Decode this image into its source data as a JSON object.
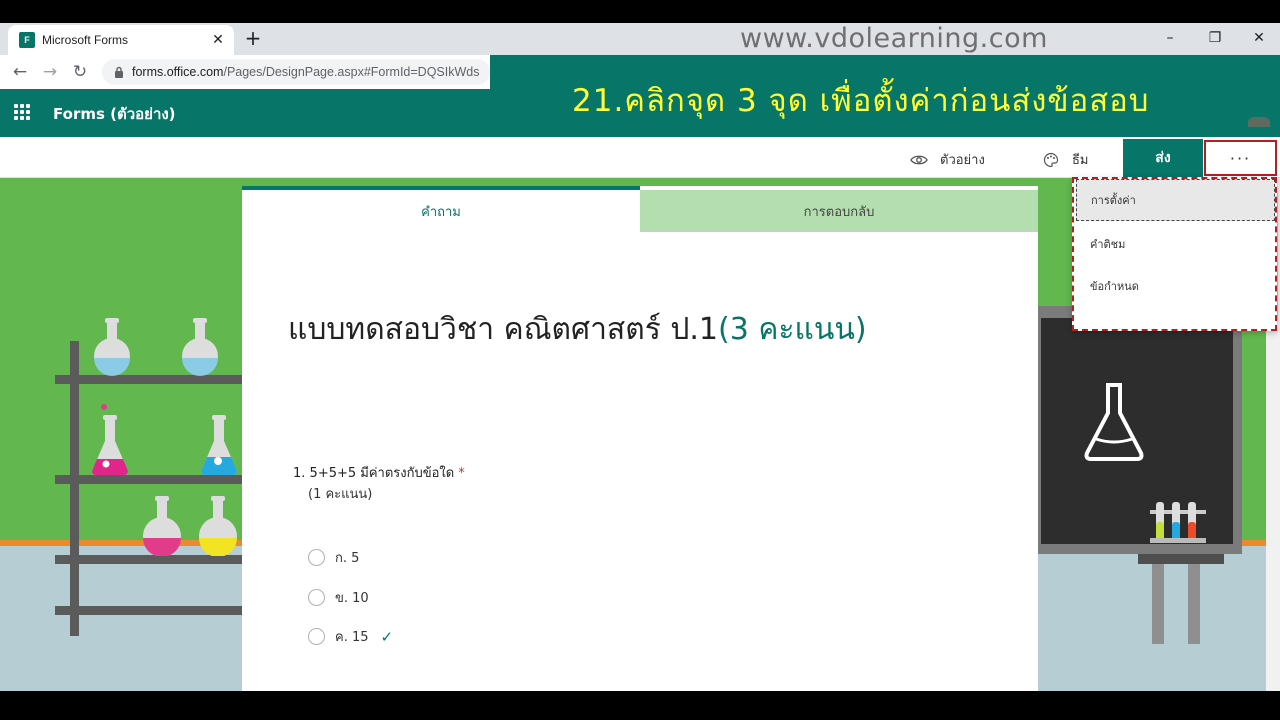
{
  "browser": {
    "tab_title": "Microsoft Forms",
    "favicon_letter": "F",
    "new_tab": "+",
    "url_host": "forms.office.com",
    "url_path": "/Pages/DesignPage.aspx#FormId=DQSIkWds",
    "window_controls": [
      "–",
      "❐",
      "✕"
    ]
  },
  "watermark": "www.vdolearning.com",
  "instruction": "21.คลิกจุด 3 จุด เพื่อตั้งค่าก่อนส่งข้อสอบ",
  "app": {
    "title": "Forms (ตัวอย่าง)"
  },
  "toolbar": {
    "preview_label": "ตัวอย่าง",
    "theme_label": "ธีม",
    "send_label": "ส่ง",
    "more_label": "···"
  },
  "menu": {
    "items": [
      "การตั้งค่า",
      "คำติชม",
      "ข้อกำหนด"
    ]
  },
  "form": {
    "tabs": [
      "คำถาม",
      "การตอบกลับ"
    ],
    "title_main": "แบบทดสอบวิชา คณิตศาสตร์ ป.1",
    "title_points": "(3 คะแนน)",
    "question": {
      "number": "1.",
      "text": "5+5+5 มีค่าตรงกับข้อใด",
      "required_mark": "*",
      "points": "(1 คะแนน)",
      "options": [
        "ก. 5",
        "ข. 10",
        "ค. 15"
      ],
      "correct_mark": "✓"
    }
  },
  "colors": {
    "brand": "#077568",
    "instruction_text": "#ffff33",
    "highlight_border": "#b51f1f"
  }
}
